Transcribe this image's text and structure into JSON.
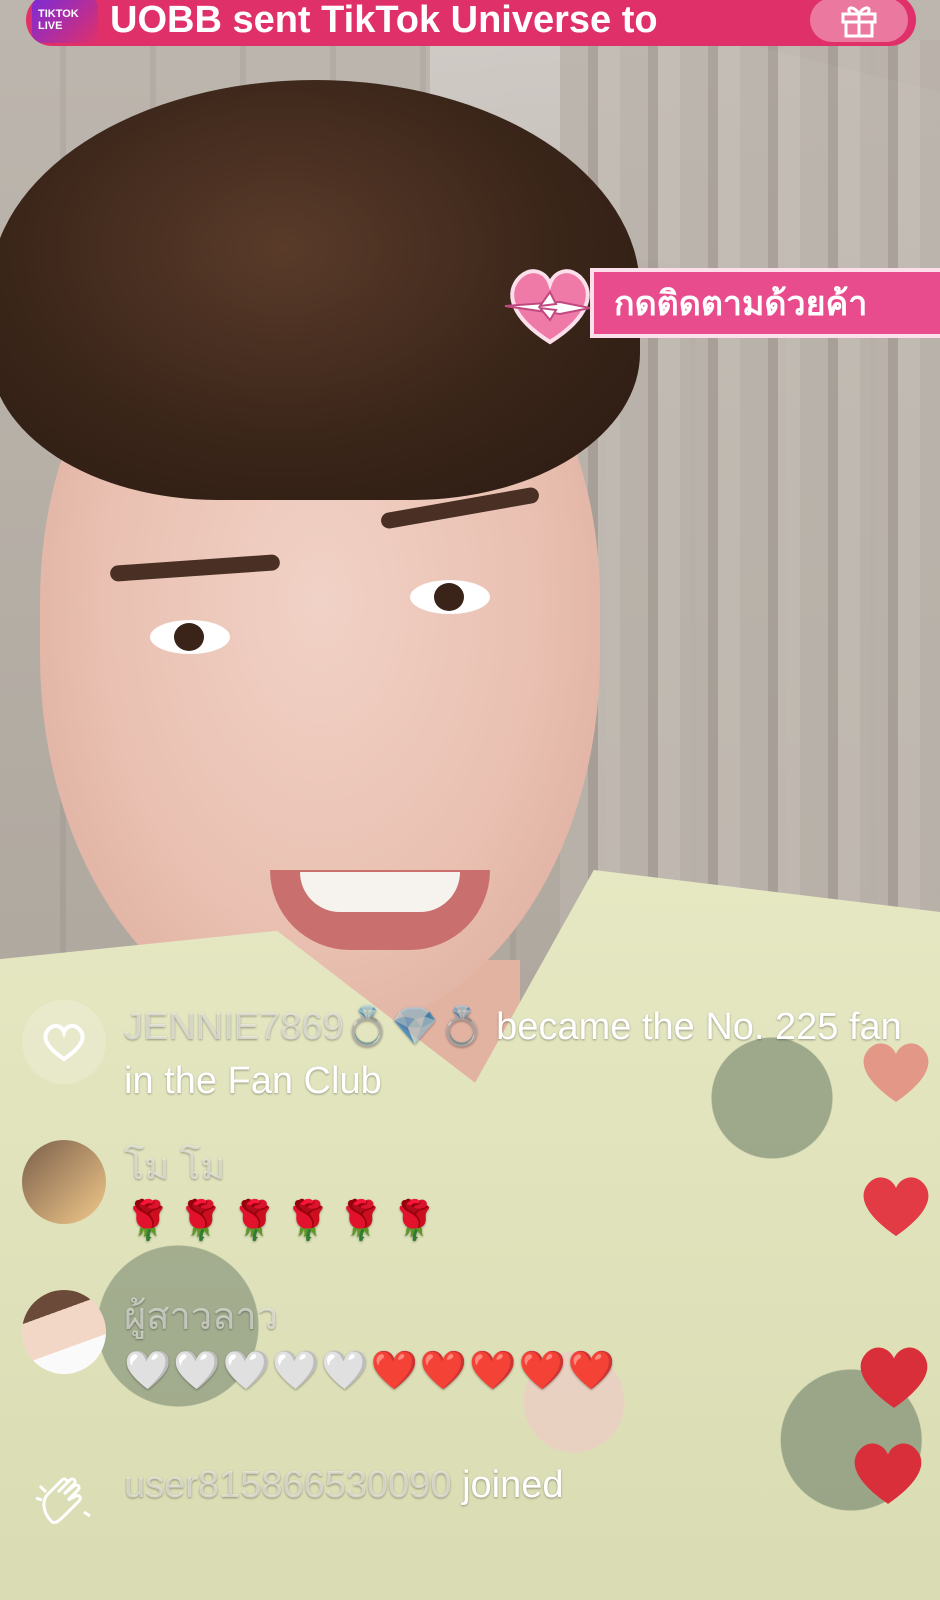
{
  "gift_banner": {
    "logo_text": "TIKTOK LIVE",
    "message": "UOBB sent TikTok Universe to"
  },
  "follow_sticker": {
    "text": "กดติดตามด้วยค้า"
  },
  "chat": [
    {
      "type": "system",
      "username": "JENNIE7869💍💎💍",
      "text": " became the No. 225 fan in the Fan Club"
    },
    {
      "type": "comment",
      "username": "โม โม",
      "text": "🌹🌹🌹🌹🌹🌹"
    },
    {
      "type": "comment",
      "username": "ผู้สาวลาว",
      "text": "🤍🤍🤍🤍🤍❤️❤️❤️❤️❤️"
    },
    {
      "type": "join",
      "username": "user815866530090",
      "text": " joined"
    }
  ],
  "colors": {
    "banner": "#e0306a",
    "sticker": "#e94c8c",
    "heart": "#e23b45"
  }
}
